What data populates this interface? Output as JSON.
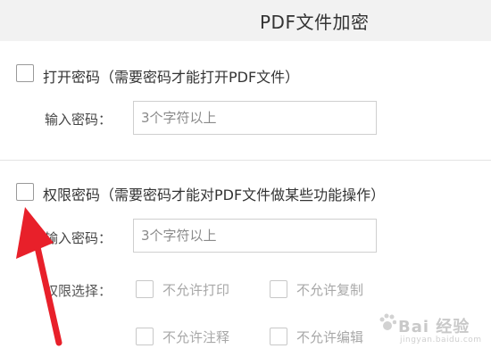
{
  "dialog": {
    "title": "PDF文件加密"
  },
  "open_password": {
    "label": "打开密码（需要密码才能打开PDF文件）",
    "field_label": "输入密码：",
    "placeholder": "3个字符以上"
  },
  "permission_password": {
    "label": "权限密码（需要密码才能对PDF文件做某些功能操作）",
    "field_label": "输入密码：",
    "placeholder": "3个字符以上",
    "select_label": "权限选择：",
    "options": [
      {
        "label": "不允许打印"
      },
      {
        "label": "不允许复制"
      },
      {
        "label": "不允许注释"
      },
      {
        "label": "不允许编辑"
      }
    ]
  },
  "annotation": {
    "arrow_color": "#e8202a"
  },
  "watermark": {
    "brand": "Bai 经验",
    "sub": "jingyan.baidu.com"
  }
}
